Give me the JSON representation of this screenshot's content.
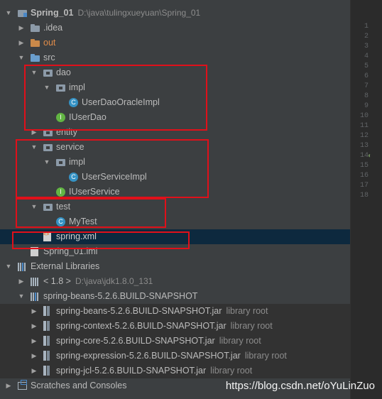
{
  "tree": {
    "project": {
      "name": "Spring_01",
      "path": "D:\\java\\tulingxueyuan\\Spring_01"
    },
    "idea": ".idea",
    "out": "out",
    "src": "src",
    "dao": "dao",
    "dao_impl": "impl",
    "dao_impl_class": "UserDaoOracleImpl",
    "dao_interface": "IUserDao",
    "entity": "entity",
    "service": "service",
    "service_impl": "impl",
    "service_impl_class": "UserServiceImpl",
    "service_interface": "IUserService",
    "test": "test",
    "test_class": "MyTest",
    "spring_xml": "spring.xml",
    "iml": "Spring_01.iml",
    "external_libraries": "External Libraries",
    "jdk": {
      "name": "< 1.8 >",
      "path": "D:\\java\\jdk1.8.0_131"
    },
    "spring_beans_lib": "spring-beans-5.2.6.BUILD-SNAPSHOT",
    "jars": [
      {
        "name": "spring-beans-5.2.6.BUILD-SNAPSHOT.jar",
        "tag": "library root"
      },
      {
        "name": "spring-context-5.2.6.BUILD-SNAPSHOT.jar",
        "tag": "library root"
      },
      {
        "name": "spring-core-5.2.6.BUILD-SNAPSHOT.jar",
        "tag": "library root"
      },
      {
        "name": "spring-expression-5.2.6.BUILD-SNAPSHOT.jar",
        "tag": "library root"
      },
      {
        "name": "spring-jcl-5.2.6.BUILD-SNAPSHOT.jar",
        "tag": "library root"
      }
    ],
    "scratches": "Scratches and Consoles"
  },
  "icons": {
    "class_letter": "C",
    "interface_letter": "I"
  },
  "gutter": {
    "line_numbers": [
      "1",
      "2",
      "3",
      "4",
      "5",
      "6",
      "7",
      "8",
      "9",
      "10",
      "11",
      "12",
      "13",
      "14",
      "15",
      "16",
      "17",
      "18"
    ]
  },
  "watermark": "https://blog.csdn.net/oYuLinZuo",
  "colors": {
    "highlight_box": "#e0101a",
    "selection": "#0d293e",
    "class_icon": "#3592c4",
    "interface_icon": "#62b543"
  }
}
